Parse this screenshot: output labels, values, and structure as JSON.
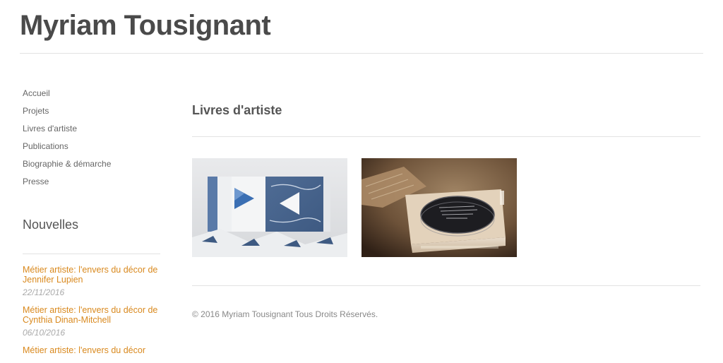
{
  "site": {
    "title": "Myriam Tousignant"
  },
  "nav": [
    {
      "label": "Accueil"
    },
    {
      "label": "Projets"
    },
    {
      "label": "Livres d'artiste"
    },
    {
      "label": "Publications"
    },
    {
      "label": "Biographie & démarche"
    },
    {
      "label": "Presse"
    }
  ],
  "news": {
    "title": "Nouvelles",
    "items": [
      {
        "title": "Métier artiste: l'envers du décor de Jennifer Lupien",
        "date": "22/11/2016"
      },
      {
        "title": "Métier artiste: l'envers du décor de Cynthia Dinan-Mitchell",
        "date": "06/10/2016"
      },
      {
        "title": "Métier artiste: l'envers du décor",
        "date": ""
      }
    ]
  },
  "main": {
    "heading": "Livres d'artiste",
    "images": [
      {
        "name": "artist-book-triangles"
      },
      {
        "name": "artist-book-disc-box"
      }
    ]
  },
  "footer": {
    "text": "© 2016 Myriam Tousignant Tous Droits Réservés."
  },
  "colors": {
    "accent": "#d9891e",
    "text": "#555555",
    "rule": "#e2e2e2"
  }
}
